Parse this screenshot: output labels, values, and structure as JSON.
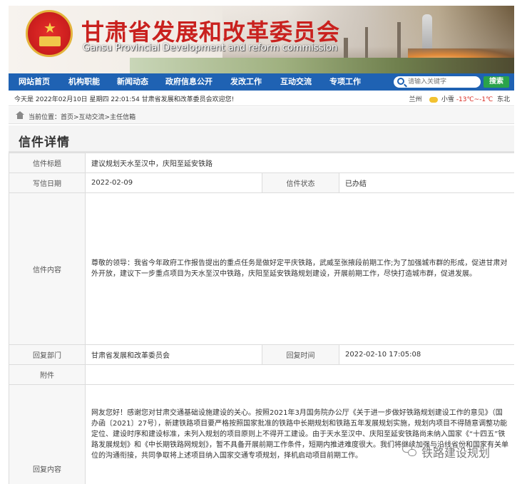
{
  "header": {
    "title": "甘肃省发展和改革委员会",
    "subtitle": "Gansu Provincial Development and reform commission"
  },
  "nav": {
    "items": [
      "网站首页",
      "机构职能",
      "新闻动态",
      "政府信息公开",
      "发改工作",
      "互动交流",
      "专项工作"
    ],
    "search_placeholder": "请输入关键字",
    "search_button": "搜索"
  },
  "datebar": {
    "date": "今天是 2022年02月10日 星期四 22:01:54 甘肃省发展和改革委员会欢迎您!",
    "city": "兰州",
    "weather": "小雪",
    "temp": "-13℃~-1℃",
    "wind": "东北"
  },
  "breadcrumb": {
    "prefix": "当前位置：",
    "path": "首页>互动交流>主任信箱"
  },
  "detail": {
    "section_title": "信件详情",
    "labels": {
      "subject": "信件标题",
      "date": "写信日期",
      "status": "信件状态",
      "content": "信件内容",
      "dept": "回复部门",
      "reply_time": "回复时间",
      "attachment": "附件",
      "reply_content": "回复内容"
    },
    "subject": "建议规划天水至汉中，庆阳至延安铁路",
    "date": "2022-02-09",
    "status": "已办结",
    "content": "尊敬的领导：我省今年政府工作报告提出的重点任务是做好定平庆铁路，武威至张掖段前期工作;为了加强城市群的形成，促进甘肃对外开放，建议下一步重点项目为天水至汉中铁路，庆阳至延安铁路规划建设，开展前期工作，尽快打造城市群，促进发展。",
    "dept": "甘肃省发展和改革委员会",
    "reply_time": "2022-02-10 17:05:08",
    "attachment": "",
    "reply_content": "网友您好！感谢您对甘肃交通基础设施建设的关心。按照2021年3月国务院办公厅《关于进一步做好铁路规划建设工作的意见》（国办函〔2021〕27号），新建铁路项目要严格按照国家批准的铁路中长期规划和铁路五年发展规划实施，规划内项目不得随意调整功能定位、建设时序和建设标准，未列入规划的项目原则上不得开工建设。由于天水至汉中、庆阳至延安铁路尚未纳入国家《“十四五”铁路发展规划》和《中长期铁路网规划》，暂不具备开展前期工作条件，短期内推进难度很大。我们将继续加强与沿线省份和国家有关单位的沟通衔接，共同争取将上述项目纳入国家交通专项规划，择机启动项目前期工作。"
  },
  "watermark": "铁路建设规划"
}
